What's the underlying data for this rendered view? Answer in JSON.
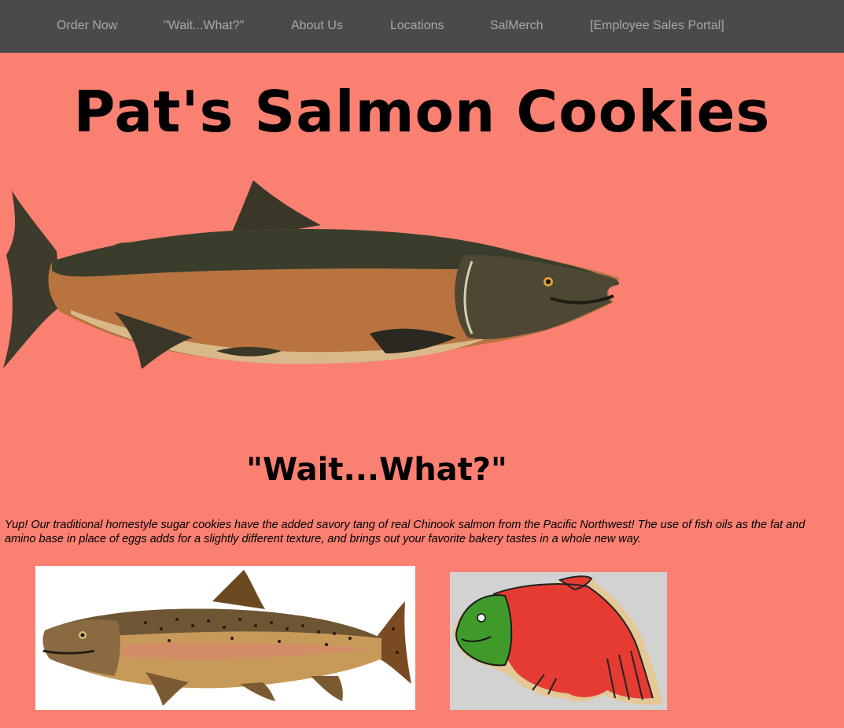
{
  "nav": {
    "items": [
      {
        "label": "Order Now"
      },
      {
        "label": "\"Wait...What?\""
      },
      {
        "label": "About Us"
      },
      {
        "label": "Locations"
      },
      {
        "label": "SalMerch"
      },
      {
        "label": "[Employee Sales Portal]"
      }
    ]
  },
  "header": {
    "title": "Pat's Salmon Cookies"
  },
  "main": {
    "heading": "\"Wait...What?\"",
    "description": "Yup! Our traditional homestyle sugar cookies have the added savory tang of real Chinook salmon from the Pacific Northwest! The use of fish oils as the fat and amino base in place of eggs adds for a slightly different texture, and brings out your favorite bakery tastes in a whole new way."
  },
  "colors": {
    "background": "#fa8072",
    "nav_background": "#4a4a4a",
    "nav_text": "#a8a8a8",
    "cookie_icing_red": "#e53b33",
    "cookie_icing_green": "#3f9a2a"
  }
}
